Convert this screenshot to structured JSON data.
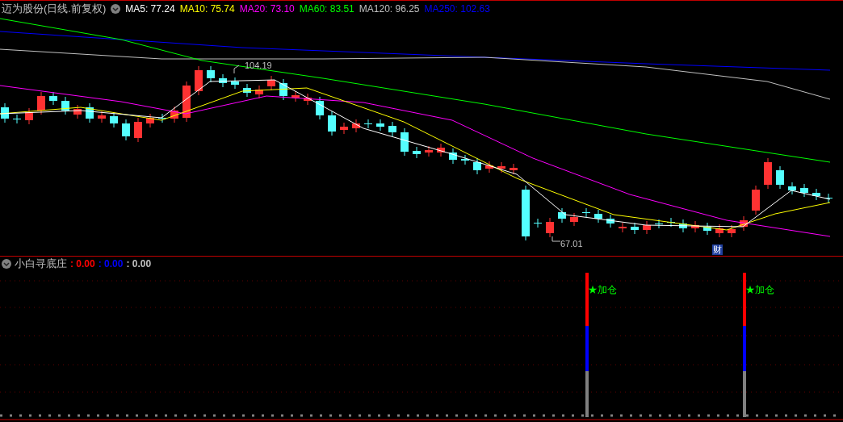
{
  "chart": {
    "title": "迈为股份(日线.前复权)",
    "ma_legend": [
      {
        "label": "MA5: 77.24",
        "color": "#ffffff"
      },
      {
        "label": "MA10: 75.74",
        "color": "#ffff00"
      },
      {
        "label": "MA20: 73.10",
        "color": "#ff00ff"
      },
      {
        "label": "MA60: 83.51",
        "color": "#00ff00"
      },
      {
        "label": "MA120: 96.25",
        "color": "#c0c0c0"
      },
      {
        "label": "MA250: 102.63",
        "color": "#0000ff"
      }
    ],
    "high_label": "104.19",
    "low_label": "67.01",
    "event_badge": "财"
  },
  "indicator": {
    "title": "小白寻底庄",
    "values": [
      {
        "text": ": 0.00",
        "color": "#ff0000"
      },
      {
        "text": ": 0.00",
        "color": "#0000ff"
      },
      {
        "text": ": 0.00",
        "color": "#c0c0c0"
      }
    ],
    "signals": [
      "★加仓",
      "★加仓"
    ]
  }
}
